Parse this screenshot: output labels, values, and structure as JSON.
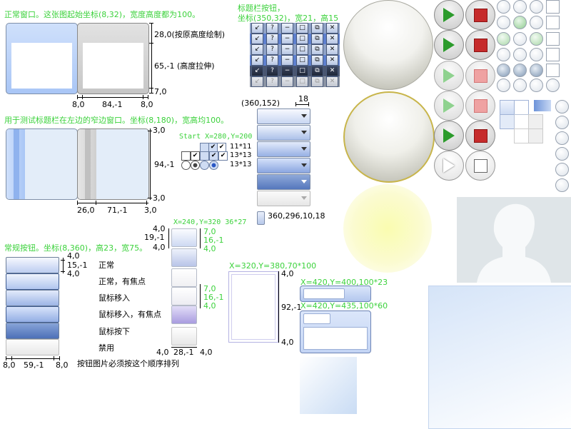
{
  "header_texts": {
    "normal_window_caption": "正常窗口。这张图起始坐标(8,32)，宽度高度都为100。",
    "titlebar_buttons_caption_line1": "标题栏按钮，",
    "titlebar_buttons_caption_line2": "坐标(350,32)，宽21，高15",
    "narrow_window_caption": "用于测试标题栏在左边的窄边窗口。坐标(8,180)，宽高均100。",
    "regular_button_caption": "常规按钮。坐标(8,360)，高23，宽75。"
  },
  "normal_window": {
    "right_label_top": "28,0(按原高度绘制)",
    "right_label_mid": "65,-1 (高度拉伸)",
    "right_label_bottom": "7,0",
    "bottom_left": "8,0",
    "bottom_mid": "84,-1",
    "bottom_right": "8,0"
  },
  "narrow_window": {
    "right_top": "3,0",
    "right_mid": "94,-1",
    "right_bottom": "3,0",
    "bottom_left": "26,0",
    "bottom_mid": "71,-1",
    "bottom_right": "3,0"
  },
  "checkbox_block": {
    "start_label": "Start X=280,Y=200",
    "size_a": "11*11",
    "size_b": "13*13",
    "size_c": "13*13"
  },
  "dropdown_block": {
    "origin": "(360,152)",
    "width": "18",
    "bottom_label": "360,296,10,18"
  },
  "regular_buttons": {
    "labels": [
      "正常",
      "正常，有焦点",
      "鼠标移入",
      "鼠标移入，有焦点",
      "鼠标按下",
      "禁用"
    ],
    "side_top": "4,0",
    "side_mid": "15,-1",
    "side_bottom": "4,0",
    "bottom_left": "8,0",
    "bottom_mid": "59,-1",
    "bottom_right": "8,0",
    "note": "按钮图片必须按这个顺序排列"
  },
  "push_buttons": {
    "caption": "X=240,Y=320  36*27",
    "left_top": "4,0",
    "left_mid": "19,-1",
    "left_bottom": "4,0",
    "right_top1": "7,0",
    "right_mid1": "16,-1",
    "right_bot1": "4,0",
    "right_top2": "7,0",
    "right_mid2": "16,-1",
    "right_bot2": "4,0",
    "bottom_left": "4,0",
    "bottom_mid": "28,-1",
    "bottom_right": "4,0"
  },
  "panel": {
    "caption": "X=320,Y=380,70*100",
    "right_top": "4,0",
    "right_mid": "92,-1",
    "right_bottom": "4,0"
  },
  "edit_small": {
    "caption": "X=420,Y=400,100*23"
  },
  "combo_large": {
    "caption": "X=420,Y=435,100*60"
  },
  "colors": {
    "caption_green": "#3cd23c",
    "window_blue": "#a9c6f6",
    "window_gray": "#c6c6c6",
    "play_green": "#2c9b2c",
    "stop_red": "#c62b2b",
    "glow_yellow": "#fafcb0",
    "avatar_bg": "#dfe5e8"
  }
}
